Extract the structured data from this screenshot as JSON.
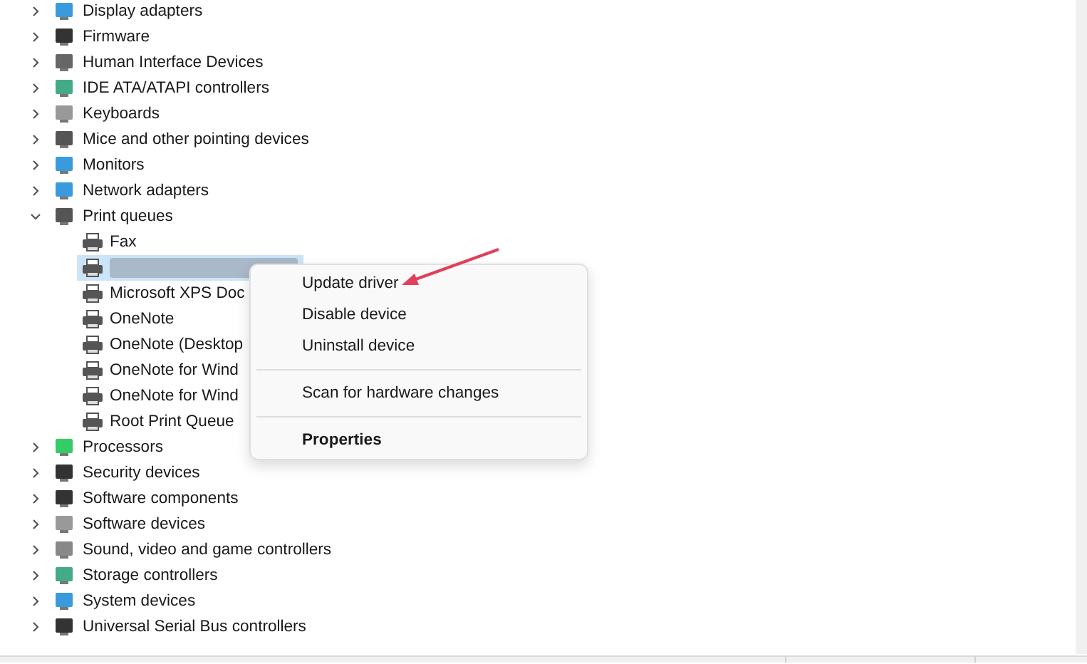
{
  "tree": [
    {
      "label": "Display adapters",
      "expanded": false
    },
    {
      "label": "Firmware",
      "expanded": false
    },
    {
      "label": "Human Interface Devices",
      "expanded": false
    },
    {
      "label": "IDE ATA/ATAPI controllers",
      "expanded": false
    },
    {
      "label": "Keyboards",
      "expanded": false
    },
    {
      "label": "Mice and other pointing devices",
      "expanded": false
    },
    {
      "label": "Monitors",
      "expanded": false
    },
    {
      "label": "Network adapters",
      "expanded": false
    },
    {
      "label": "Print queues",
      "expanded": true,
      "children": [
        {
          "kind": "device",
          "label": "Fax",
          "selected": false
        },
        {
          "kind": "redacted",
          "selected": true
        },
        {
          "kind": "device",
          "label": "Microsoft XPS Doc",
          "selected": false
        },
        {
          "kind": "device",
          "label": "OneNote",
          "selected": false
        },
        {
          "kind": "device",
          "label": "OneNote (Desktop",
          "selected": false
        },
        {
          "kind": "device",
          "label": "OneNote for Wind",
          "selected": false
        },
        {
          "kind": "device",
          "label": "OneNote for Wind",
          "selected": false
        },
        {
          "kind": "device",
          "label": "Root Print Queue",
          "selected": false
        }
      ]
    },
    {
      "label": "Processors",
      "expanded": false
    },
    {
      "label": "Security devices",
      "expanded": false
    },
    {
      "label": "Software components",
      "expanded": false
    },
    {
      "label": "Software devices",
      "expanded": false
    },
    {
      "label": "Sound, video and game controllers",
      "expanded": false
    },
    {
      "label": "Storage controllers",
      "expanded": false
    },
    {
      "label": "System devices",
      "expanded": false
    },
    {
      "label": "Universal Serial Bus controllers",
      "expanded": false
    }
  ],
  "context_menu": [
    {
      "kind": "item",
      "label": "Update driver"
    },
    {
      "kind": "item",
      "label": "Disable device"
    },
    {
      "kind": "item",
      "label": "Uninstall device"
    },
    {
      "kind": "separator"
    },
    {
      "kind": "item",
      "label": "Scan for hardware changes"
    },
    {
      "kind": "separator"
    },
    {
      "kind": "default",
      "label": "Properties"
    }
  ]
}
